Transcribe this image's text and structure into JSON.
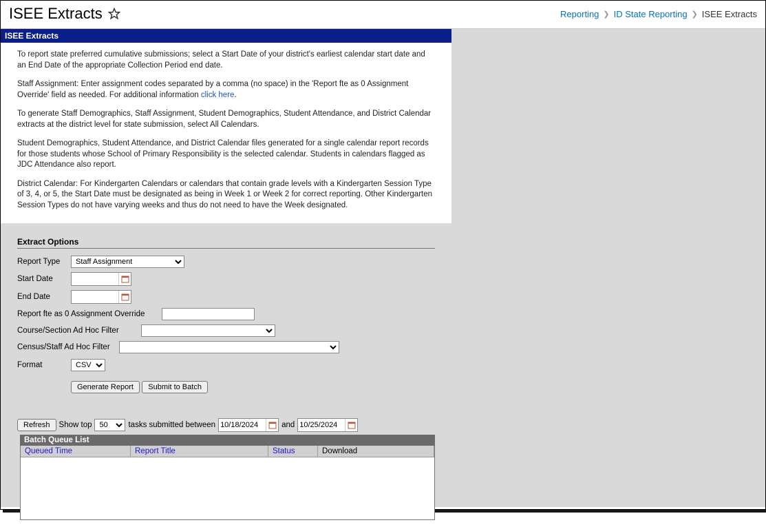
{
  "header": {
    "title": "ISEE Extracts"
  },
  "breadcrumb": {
    "item1": "Reporting",
    "item2": "ID State Reporting",
    "current": "ISEE Extracts"
  },
  "panel": {
    "title": "ISEE Extracts",
    "p1": "To report state preferred cumulative submissions; select a Start Date of your district's earliest calendar start date and an End Date of the appropriate Collection Period end date.",
    "p2a": "Staff Assignment: Enter assignment codes separated by a comma (no space) in the 'Report fte as 0 Assignment Override' field as needed. For additional information ",
    "p2link": "click here",
    "p2b": ".",
    "p3": "To generate Staff Demographics, Staff Assignment, Student Demographics, Student Attendance, and District Calendar extracts at the district level for state submission, select All Calendars.",
    "p4": "Student Demographics, Student Attendance, and District Calendar files generated for a single calendar report records for those students whose School of Primary Responsibility is the selected calendar. Students in calendars flagged as JDC Attendance also report.",
    "p5": "District Calendar: For Kindergarten Calendars or calendars that contain grade levels with a Kindergarten Session Type of 3, 4, or 5, the Start Date must be designated as being in Week 1 or Week 2 for correct reporting. Other Kindergarten Session Types do not have varying weeks and thus do not need to have the Week designated."
  },
  "options": {
    "section_title": "Extract Options",
    "report_type_label": "Report Type",
    "report_type_value": "Staff Assignment",
    "start_date_label": "Start Date",
    "start_date_value": "",
    "end_date_label": "End Date",
    "end_date_value": "",
    "override_label": "Report fte as 0 Assignment Override",
    "override_value": "",
    "course_filter_label": "Course/Section Ad Hoc Filter",
    "course_filter_value": "",
    "census_filter_label": "Census/Staff Ad Hoc Filter",
    "census_filter_value": "",
    "format_label": "Format",
    "format_value": "CSV",
    "generate_btn": "Generate Report",
    "submit_btn": "Submit to Batch"
  },
  "batch": {
    "refresh_btn": "Refresh",
    "show_top_label": "Show top",
    "show_top_value": "50",
    "tasks_label": "tasks submitted between",
    "date_from": "10/18/2024",
    "and_label": "and",
    "date_to": "10/25/2024",
    "list_title": "Batch Queue List",
    "col_time": "Queued Time",
    "col_title": "Report Title",
    "col_status": "Status",
    "col_download": "Download"
  }
}
